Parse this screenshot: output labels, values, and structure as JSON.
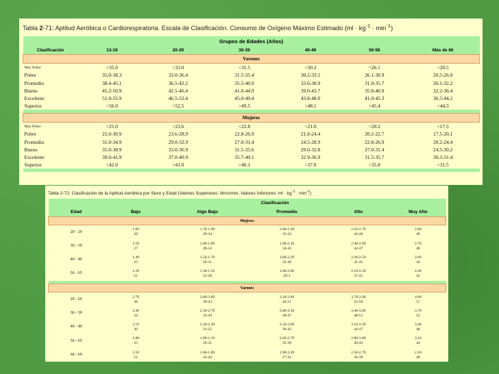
{
  "table1": {
    "caption_prefix": "Tabla ",
    "caption_num": "2",
    "caption_main": "-71: Aptitud Aeróbica o Cardiorespiratoria. Escala de Clasificación. Consumo de Oxígeno Máximo Estimado (ml · kg",
    "caption_sup1": "-1",
    "caption_mid": " · min",
    "caption_sup2": "-1",
    "caption_end": ")",
    "group_header": "Grupos de Edades (Años)",
    "columns": [
      "Clasificación",
      "13-19",
      "20-29",
      "30-39",
      "40-49",
      "50-59",
      "Más de 60"
    ],
    "sections": [
      {
        "title": "Varones",
        "rows": [
          {
            "label": "Muy Pobre",
            "values": [
              "<35.0",
              "<33.0",
              "<31.5",
              "<30.2",
              "<26.1",
              "<20.5"
            ]
          },
          {
            "label": "Pobre",
            "values": [
              "35.0-38.3",
              "33.0-36.4",
              "31.5-35.4",
              "30.2-33.5",
              "26.1-30.9",
              "20.5-26.0"
            ]
          },
          {
            "label": "Promedio",
            "values": [
              "38.4-45.1",
              "36.5-42.2",
              "35.5-40.9",
              "33.6-38.9",
              "31.0-35.7",
              "26.1-32.2"
            ]
          },
          {
            "label": "Bueno",
            "values": [
              "45.2-50.9",
              "42.5-46.4",
              "41.0-44.9",
              "39.0-43.7",
              "35.8-40.9",
              "32.2-36.4"
            ]
          },
          {
            "label": "Excelente",
            "values": [
              "51.0-55.9",
              "46.5-52.4",
              "45.0-49.4",
              "43.8-48.0",
              "41.0-45.3",
              "36.5-44.2"
            ]
          },
          {
            "label": "Superior",
            "values": [
              ">56.0",
              ">52.5",
              ">49.5",
              ">48.1",
              ">45.4",
              ">44.3"
            ]
          }
        ]
      },
      {
        "title": "Mujeres",
        "rows": [
          {
            "label": "Muy Pobre",
            "values": [
              "<25.0",
              "<23.6",
              "<22.8",
              "<21.0",
              "<20.2",
              "<17.5"
            ]
          },
          {
            "label": "Pobre",
            "values": [
              "25.0-30.9",
              "23.6-28.9",
              "22.8-26.9",
              "21.0-24.4",
              "20.2-22.7",
              "17.5-20.1"
            ]
          },
          {
            "label": "Promedio",
            "values": [
              "31.0-34.9",
              "29.0-32.9",
              "27.0-31.4",
              "24.5-28.9",
              "22.8-26.9",
              "20.2-24.4"
            ]
          },
          {
            "label": "Bueno",
            "values": [
              "35.0-38.9",
              "33.0-36.9",
              "31.5-35.6",
              "29.0-32.8",
              "27.0-31.4",
              "24.5-30.2"
            ]
          },
          {
            "label": "Excelente",
            "values": [
              "39.0-41.9",
              "37.0-40.9",
              "35.7-40.1",
              "32.9-36.9",
              "31.5-35.7",
              "30.3-31.4"
            ]
          },
          {
            "label": "Superior",
            "values": [
              ">42.0",
              ">41.0",
              ">40.1",
              ">37.0",
              ">35.8",
              ">31.5"
            ]
          }
        ]
      }
    ]
  },
  "table2": {
    "caption_main": "Tabla 2-72: Clasificación de la Aptitud Aeróbica por Sexo y Edad (Valores Superiores: litros/min, Valores Inferiores: ml · kg",
    "caption_sup1": "-1",
    "caption_mid": " · min",
    "caption_sup2": "-1",
    "caption_end": ")",
    "group_header": "Clasificación",
    "columns": [
      "Edad",
      "Bajo",
      "Algo Bajo",
      "Promedio",
      "Alto",
      "Muy Alto"
    ],
    "sections": [
      {
        "title": "Mujeres",
        "rows": [
          {
            "age": "20 - 29",
            "values": [
              [
                "1.69",
                "28"
              ],
              [
                "1.70-1.99",
                "29-34"
              ],
              [
                "2.00-2.49",
                "35-43"
              ],
              [
                "2.50-2.79",
                "44-48"
              ],
              [
                "2.80",
                "49"
              ]
            ]
          },
          {
            "age": "30 - 39",
            "values": [
              [
                "1.59",
                "27"
              ],
              [
                "1.60-1.89",
                "28-33"
              ],
              [
                "1.90-2.39",
                "34-41"
              ],
              [
                "2.40-2.69",
                "42-47"
              ],
              [
                "2.70",
                "48"
              ]
            ]
          },
          {
            "age": "40 - 49",
            "values": [
              [
                "1.49",
                "25"
              ],
              [
                "1.50-1.79",
                "26-31"
              ],
              [
                "1.80-2.29",
                "32-40"
              ],
              [
                "2.30-2.59",
                "41-45"
              ],
              [
                "2.60",
                "46"
              ]
            ]
          },
          {
            "age": "50 - 65",
            "values": [
              [
                "1.29",
                "21"
              ],
              [
                "1.30-1.59",
                "22-28"
              ],
              [
                "1.60-2.09",
                "29-3"
              ],
              [
                "2.10-2.39",
                "37-41"
              ],
              [
                "2.40",
                "42"
              ]
            ]
          }
        ]
      },
      {
        "title": "Varones",
        "rows": [
          {
            "age": "20 - 29",
            "values": [
              [
                "2.79",
                "38"
              ],
              [
                "2.80-3.09",
                "39-43"
              ],
              [
                "3.10-3.69",
                "44-51"
              ],
              [
                "3.70-3.99",
                "52-56"
              ],
              [
                "4.00",
                "57"
              ]
            ]
          },
          {
            "age": "30 - 39",
            "values": [
              [
                "2.49",
                "34"
              ],
              [
                "2.50-2.79",
                "35-39"
              ],
              [
                "2.80-3.39",
                "40-47"
              ],
              [
                "3.40-3.69",
                "48-51"
              ],
              [
                "3.70",
                "52"
              ]
            ]
          },
          {
            "age": "40 - 49",
            "values": [
              [
                "2.19",
                "30"
              ],
              [
                "2.20-2.49",
                "31-35"
              ],
              [
                "2.50-3.09",
                "36-43"
              ],
              [
                "3.10-3.39",
                "44-47"
              ],
              [
                "3.40",
                "48"
              ]
            ]
          },
          {
            "age": "50 - 65",
            "values": [
              [
                "1.89",
                "25"
              ],
              [
                "1.90-2.19",
                "26-31"
              ],
              [
                "2.20-2.79",
                "32-39"
              ],
              [
                "2.80-3.09",
                "40-43"
              ],
              [
                "3.10",
                "44"
              ]
            ]
          },
          {
            "age": "60 - 69",
            "values": [
              [
                "1.59",
                "21"
              ],
              [
                "1.60-1.89",
                "22-26"
              ],
              [
                "1.90-2.49",
                "27-35"
              ],
              [
                "2.50-2.79",
                "36-39"
              ],
              [
                "2.10",
                "40"
              ]
            ]
          }
        ]
      }
    ]
  }
}
